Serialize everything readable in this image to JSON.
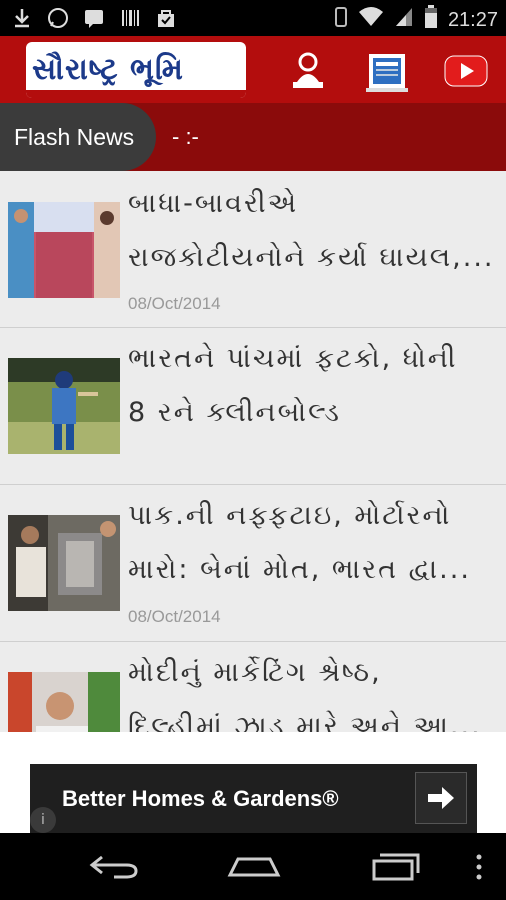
{
  "status_bar": {
    "time": "21:27"
  },
  "app": {
    "logo_text": "સૌરાષ્ટ્ર ભૂમિ",
    "actions": [
      "profile-icon",
      "news-paper-icon",
      "youtube-icon"
    ]
  },
  "flash_news": {
    "label": "Flash News",
    "ticker": "- :-"
  },
  "articles": [
    {
      "title_line1": "બાધા-બાવરીએ",
      "title_line2": "રાજકોટીયનોને કર્યા ઘાયલ,...",
      "date": "08/Oct/2014"
    },
    {
      "title_line1": "ભારતને પાંચમાં ફટકો, ધોની",
      "title_line2": "8 રને ક્લીનબોલ્ડ",
      "date": ""
    },
    {
      "title_line1": "પાક.ની નફ્ફટાઇ, મોર્ટારનો",
      "title_line2": "મારો: બેનાં મોત, ભારત દ્વા...",
      "date": "08/Oct/2014"
    },
    {
      "title_line1": "મોદીનું માર્કેટિંગ શ્રેષ્ઠ,",
      "title_line2": "દિલ્હીમાં ઝાડ મારે અને આ...",
      "date": ""
    }
  ],
  "ad": {
    "text": "Better Homes & Gardens®",
    "info": "i"
  },
  "colors": {
    "app_bar": "#b30d0d",
    "flash_bar": "#8b0b0b",
    "flash_tag": "#3b3b3b"
  }
}
